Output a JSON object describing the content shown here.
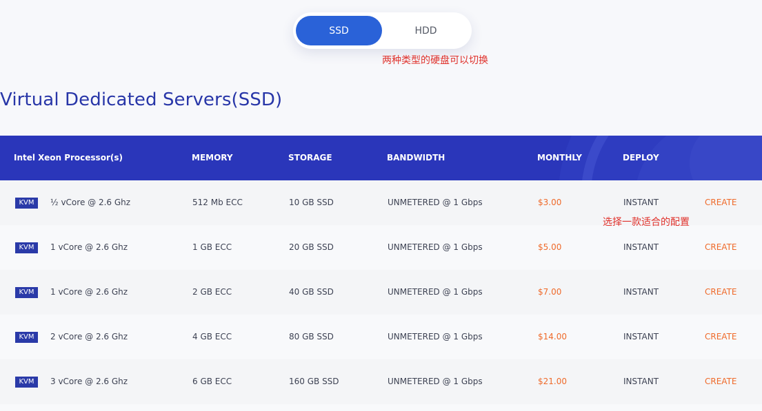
{
  "toggle": {
    "active_label": "SSD",
    "inactive_label": "HDD"
  },
  "annotations": {
    "toggle_note": "两种类型的硬盘可以切换",
    "row_note": "选择一款适合的配置"
  },
  "page_title": "Virtual Dedicated Servers(SSD)",
  "table": {
    "headers": {
      "processor": "Intel Xeon Processor(s)",
      "memory": "MEMORY",
      "storage": "STORAGE",
      "bandwidth": "BANDWIDTH",
      "monthly": "MONTHLY",
      "deploy": "DEPLOY"
    },
    "rows": [
      {
        "badge": "KVM",
        "cpu": "½ vCore @ 2.6 Ghz",
        "memory": "512 Mb ECC",
        "storage": "10 GB SSD",
        "bandwidth": "UNMETERED @ 1 Gbps",
        "price": "$3.00",
        "deploy": "INSTANT",
        "action": "CREATE"
      },
      {
        "badge": "KVM",
        "cpu": "1 vCore @ 2.6 Ghz",
        "memory": "1 GB ECC",
        "storage": "20 GB SSD",
        "bandwidth": "UNMETERED @ 1 Gbps",
        "price": "$5.00",
        "deploy": "INSTANT",
        "action": "CREATE"
      },
      {
        "badge": "KVM",
        "cpu": "1 vCore @ 2.6 Ghz",
        "memory": "2 GB ECC",
        "storage": "40 GB SSD",
        "bandwidth": "UNMETERED @ 1 Gbps",
        "price": "$7.00",
        "deploy": "INSTANT",
        "action": "CREATE"
      },
      {
        "badge": "KVM",
        "cpu": "2 vCore @ 2.6 Ghz",
        "memory": "4 GB ECC",
        "storage": "80 GB SSD",
        "bandwidth": "UNMETERED @ 1 Gbps",
        "price": "$14.00",
        "deploy": "INSTANT",
        "action": "CREATE"
      },
      {
        "badge": "KVM",
        "cpu": "3 vCore @ 2.6 Ghz",
        "memory": "6 GB ECC",
        "storage": "160 GB SSD",
        "bandwidth": "UNMETERED @ 1 Gbps",
        "price": "$21.00",
        "deploy": "INSTANT",
        "action": "CREATE"
      }
    ]
  },
  "colors": {
    "accent_blue": "#2a62d8",
    "header_blue": "#2a36ba",
    "title_blue": "#2836a8",
    "price_orange": "#ef6a2a",
    "annotation_red": "#e0322c"
  }
}
